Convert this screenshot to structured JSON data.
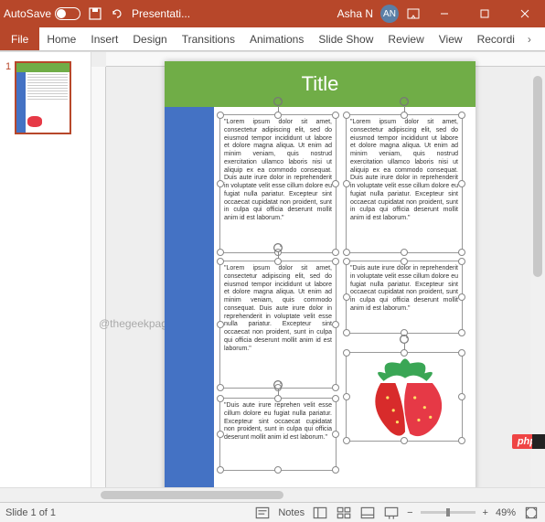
{
  "titlebar": {
    "autosave_label": "AutoSave",
    "autosave_state": "Off",
    "doc_title": "Presentati...",
    "user_name": "Asha N",
    "user_initials": "AN"
  },
  "ribbon": {
    "tabs": [
      "File",
      "Home",
      "Insert",
      "Design",
      "Transitions",
      "Animations",
      "Slide Show",
      "Review",
      "View",
      "Recordi"
    ],
    "more_glyph": "›"
  },
  "thumb": {
    "number": "1"
  },
  "slide": {
    "title": "Title",
    "lorem_long": "\"Lorem ipsum dolor sit amet, consectetur adipiscing elit, sed do eiusmod tempor incididunt ut labore et dolore magna aliqua. Ut enim ad minim veniam, quis nostrud exercitation ullamco laboris nisi ut aliquip ex ea commodo consequat. Duis aute irure dolor in reprehenderit in voluptate velit esse cillum dolore eu fugiat nulla pariatur. Excepteur sint occaecat cupidatat non proident, sunt in culpa qui officia deserunt mollit anim id est laborum.\"",
    "lorem_med": "\"Lorem ipsum dolor sit amet, consectetur adipiscing elit, sed do eiusmod tempor incididunt ut labore et dolore magna aliqua. Ut enim ad minim veniam, quis commodo consequat. Duis aute irure dolor in reprehenderit in voluptate velit esse nulla pariatur. Excepteur sint occaecat non proident, sunt in culpa qui officia deserunt mollit anim id est laborum.\"",
    "lorem_short1": "\"Duis aute irure dolor in reprehenderit in voluptate velit esse cillum dolore eu fugiat nulla pariatur. Excepteur sint occaecat cupidatat non proident, sunt in culpa qui officia deserunt mollit anim id est laborum.\"",
    "lorem_short2": "\"Duis aute irure reprehen velit esse cillum dolore eu fugiat nulla pariatur. Excepteur sint occaecat cupidatat non proident, sunt in culpa qui officia deserunt mollit anim id est laborum.\""
  },
  "watermark": "@thegeekpage.com",
  "statusbar": {
    "slide_count": "Slide 1 of 1",
    "notes_label": "Notes",
    "zoom_value": "49%",
    "zoom_minus": "−",
    "zoom_plus": "+"
  },
  "badge": {
    "php": "php"
  },
  "icons": {
    "save": "save-icon",
    "undo": "undo-icon",
    "ribbon_opts": "ribbon-options-icon",
    "min": "minimize-icon",
    "max": "maximize-icon",
    "close": "close-icon",
    "fit": "fit-icon"
  }
}
